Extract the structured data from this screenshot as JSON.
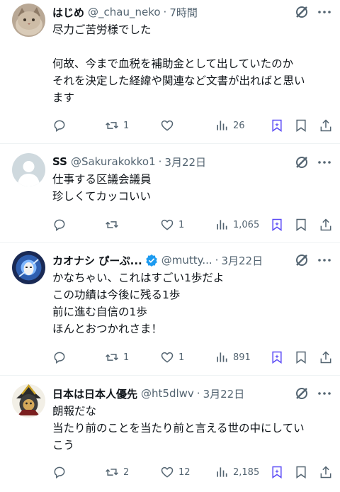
{
  "posts": [
    {
      "name": "はじめ",
      "handle": "@_chau_neko",
      "time": "7時間",
      "text": "尽力ご苦労様でした\n\n何故、今まで血税を補助金として出していたのか\nそれを決定した経緯や関連など文書が出ればと思い\nます",
      "replies": "",
      "reposts": "1",
      "likes": "",
      "views": "26"
    },
    {
      "name": "SS",
      "handle": "@Sakurakokko1",
      "time": "3月22日",
      "text": "仕事する区議会議員\n珍しくてカッコいい",
      "replies": "",
      "reposts": "",
      "likes": "1",
      "views": "1,065"
    },
    {
      "name": "カオナシ ぴーぷ...",
      "handle": "@mutty...",
      "time": "3月22日",
      "text": "かなちゃい、これはすごい1歩だよ\nこの功績は今後に残る1歩\n前に進む自信の1歩\nほんとおつかれさま！",
      "replies": "",
      "reposts": "1",
      "likes": "1",
      "views": "891"
    },
    {
      "name": "日本は日本人優先",
      "handle": "@ht5dlwv",
      "time": "3月22日",
      "text": "朗報だな\n当たり前のことを当たり前と言える世の中にしてい\nこう",
      "replies": "",
      "reposts": "2",
      "likes": "12",
      "views": "2,185"
    }
  ],
  "colors": {
    "text": "#0f1419",
    "secondary": "#536471",
    "verified": "#1d9bf0",
    "grok_purple": "#5b4bf5"
  },
  "icons": [
    "grok-icon",
    "more-icon",
    "reply-icon",
    "repost-icon",
    "like-icon",
    "views-icon",
    "bookmark-icon",
    "share-icon",
    "verified-icon"
  ]
}
